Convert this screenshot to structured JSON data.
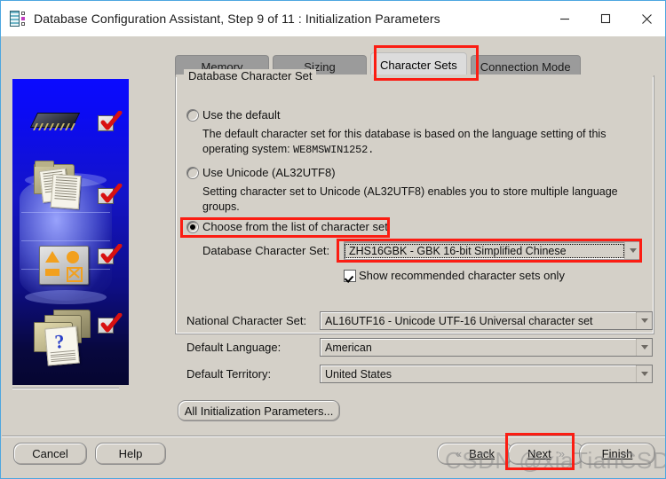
{
  "window": {
    "title": "Database Configuration Assistant, Step 9 of 11 : Initialization Parameters",
    "icon": "database-chip-icon",
    "controls": {
      "minimize": "minimize-icon",
      "maximize": "maximize-icon",
      "close": "close-icon"
    }
  },
  "tabs": [
    {
      "label": "Memory",
      "active": false
    },
    {
      "label": "Sizing",
      "active": false
    },
    {
      "label": "Character Sets",
      "active": true
    },
    {
      "label": "Connection Mode",
      "active": false
    }
  ],
  "group": {
    "title": "Database Character Set"
  },
  "options": [
    {
      "label": "Use the default",
      "selected": false,
      "description": "The default character set for this database is based on the language setting of this operating system:",
      "description_value": "WE8MSWIN1252."
    },
    {
      "label": "Use Unicode (AL32UTF8)",
      "selected": false,
      "description": "Setting character set to Unicode (AL32UTF8) enables you to store multiple language groups.",
      "description_value": ""
    },
    {
      "label": "Choose from the list of character set",
      "selected": true,
      "description": "",
      "description_value": ""
    }
  ],
  "database_character_set": {
    "label": "Database Character Set:",
    "value": "ZHS16GBK - GBK 16-bit Simplified Chinese",
    "focused": true
  },
  "show_recommended": {
    "label": "Show recommended character sets only",
    "checked": true
  },
  "fields": [
    {
      "label": "National Character Set:",
      "value": "AL16UTF16 - Unicode UTF-16 Universal character set"
    },
    {
      "label": "Default Language:",
      "value": "American"
    },
    {
      "label": "Default Territory:",
      "value": "United States"
    }
  ],
  "buttons": {
    "all_init_params": "All Initialization Parameters...",
    "cancel": "Cancel",
    "help": "Help",
    "back": "Back",
    "next": "Next",
    "finish": "Finish",
    "back_arrow": "«",
    "next_arrow": "»"
  },
  "annotations": {
    "highlight_color": "#fb1d13",
    "boxes": [
      "character-sets-tab",
      "choose-from-list-radio",
      "database-character-set-combo",
      "next-button"
    ]
  },
  "watermark": "CSDN @xiaTianCSDN",
  "illustration": {
    "name": "oracle-database-illustration",
    "checkmarks": 4
  }
}
